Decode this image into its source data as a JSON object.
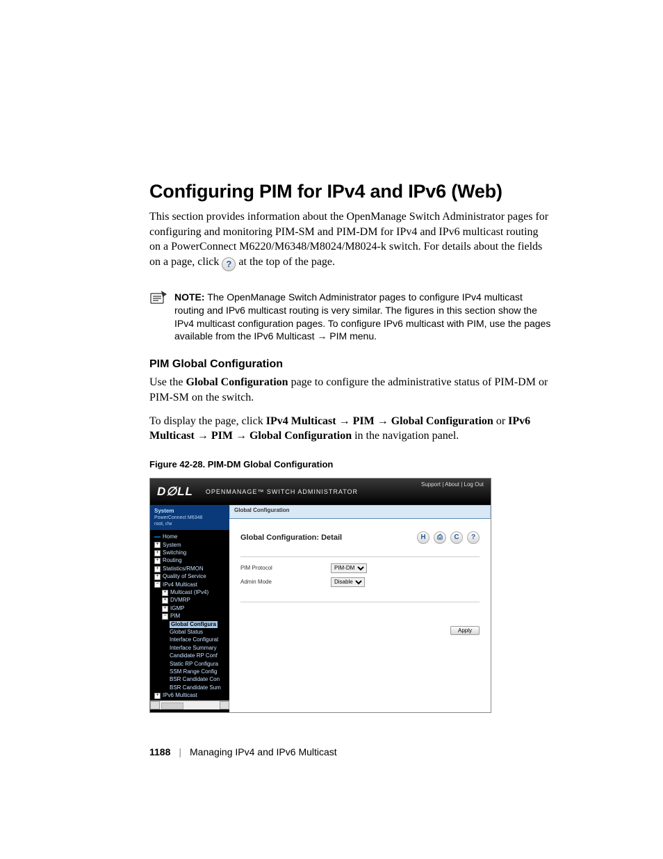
{
  "heading": "Configuring PIM for IPv4 and IPv6 (Web)",
  "intro_part1": "This section provides information about the OpenManage Switch Administrator pages for configuring and monitoring PIM-SM and PIM-DM for IPv4 and IPv6 multicast routing on a PowerConnect M6220/M6348/M8024/M8024-k switch. For details about the fields on a page, click ",
  "intro_part2": " at the top of the page.",
  "note_label": "NOTE:",
  "note_text": " The OpenManage Switch Administrator pages to configure IPv4 multicast routing and IPv6 multicast routing is very similar. The figures in this section show the IPv4 multicast configuration pages. To configure IPv6 multicast with PIM, use the pages available from the IPv6 Multicast → PIM menu.",
  "subheading": "PIM Global Configuration",
  "p1_a": "Use the ",
  "p1_b": "Global Configuration",
  "p1_c": " page to configure the administrative status of PIM-DM or PIM-SM on the switch.",
  "p2_a": "To display the page, click ",
  "p2_b": "IPv4 Multicast → PIM → Global Configuration",
  "p2_c": " or ",
  "p2_d": "IPv6 Multicast → PIM → Global Configuration",
  "p2_e": " in the navigation panel.",
  "figure_caption": "Figure 42-28.    PIM-DM Global Configuration",
  "screenshot": {
    "logo": "D∅LL",
    "app_title": "OPENMANAGE™ SWITCH  ADMINISTRATOR",
    "top_links": "Support | About | Log Out",
    "system_label": "System",
    "system_sub1": "PowerConnect M6348",
    "system_sub2": "root, r/w",
    "tree": {
      "home": "Home",
      "system": "System",
      "switching": "Switching",
      "routing": "Routing",
      "stats": "Statistics/RMON",
      "qos": "Quality of Service",
      "ipv4m": "IPv4 Multicast",
      "mcast": "Multicast (IPv4)",
      "dvmrp": "DVMRP",
      "igmp": "IGMP",
      "pim": "PIM",
      "gc": "Global Configura",
      "gs": "Global Status",
      "ifc": "Interface Configurat",
      "ifs": "Interface Summary",
      "crp": "Candidate RP Conf",
      "srp": "Static RP Configura",
      "ssm": "SSM Range Config",
      "bsrc": "BSR Candidate Con",
      "bsrs": "BSR Candidate Sum",
      "ipv6m": "IPv6 Multicast"
    },
    "tab": "Global Configuration",
    "detail_header": "Global Configuration: Detail",
    "row1_label": "PIM Protocol",
    "row1_value": "PIM-DM",
    "row2_label": "Admin Mode",
    "row2_value": "Disable",
    "apply": "Apply"
  },
  "footer": {
    "page": "1188",
    "chapter": "Managing IPv4 and IPv6 Multicast"
  }
}
